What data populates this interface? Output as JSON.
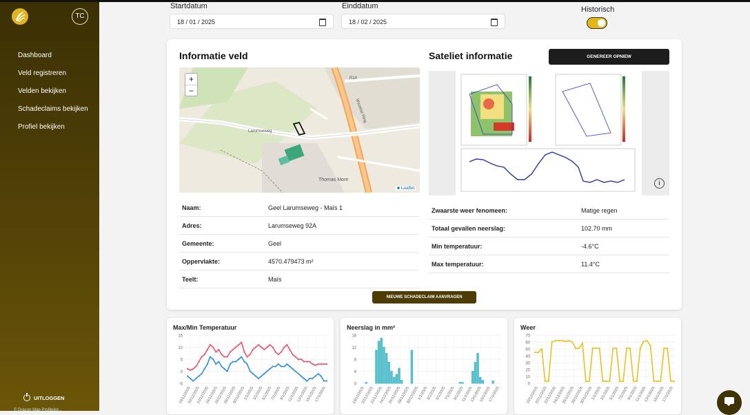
{
  "sidebar": {
    "avatar": "TC",
    "items": [
      {
        "label": "Dashboard"
      },
      {
        "label": "Veld registreren"
      },
      {
        "label": "Velden bekijken"
      },
      {
        "label": "Schadeclaims bekijken"
      },
      {
        "label": "Profiel bekijken"
      }
    ],
    "logout": "UITLOGGEN",
    "footer": "© Dracon Map Profilelist..."
  },
  "filters": {
    "start_label": "Startdatum",
    "start_value": "18 / 01 / 2025",
    "end_label": "Einddatum",
    "end_value": "18 / 02 / 2025",
    "toggle_label": "Historisch",
    "toggle_on": true
  },
  "field_info": {
    "title": "Informatie veld",
    "map": {
      "attribution": "Leaflet",
      "zoom_in": "+",
      "zoom_out": "−",
      "labels": [
        "Larumseweg",
        "Wezelse Ring",
        "R14",
        "Thomas More"
      ]
    },
    "rows": [
      {
        "key": "Naam:",
        "value": "Geel Larumseweg - Maïs 1"
      },
      {
        "key": "Adres:",
        "value": "Larumseweg 92A"
      },
      {
        "key": "Gemeente:",
        "value": "Geel"
      },
      {
        "key": "Oppervlakte:",
        "value": "4570.479473 m²"
      },
      {
        "key": "Teelt:",
        "value": "Maïs"
      }
    ]
  },
  "satellite": {
    "title": "Sateliet informatie",
    "regen_button": "GENEREER OPNIEW",
    "info_icon": "i",
    "rows": [
      {
        "key": "Zwaarste weer fenomeen:",
        "value": "Matige regen"
      },
      {
        "key": "Totaal gevallen neerslag:",
        "value": "102.70 mm"
      },
      {
        "key": "Min temperatuur:",
        "value": "-4.6°C"
      },
      {
        "key": "Max temperatuur:",
        "value": "11.4°C"
      }
    ]
  },
  "claim_button": "NIEUWE SCHADECLAIM AANVRAGEN",
  "colors": {
    "accent": "#e3b618",
    "sidebar": "#564507",
    "temp_max": "#e8546e",
    "temp_min": "#2f8fd8",
    "rain": "#3bb6c4",
    "weather": "#e7c21b"
  },
  "chart_data": [
    {
      "type": "line",
      "title": "Max/Min Temperatuur",
      "ylim": [
        -5,
        15
      ],
      "yticks": [
        15,
        10,
        5,
        0,
        -5
      ],
      "xticks": [
        "19/12/2025",
        "20/12/2025",
        "22/12/2025",
        "24/12/2025",
        "26/12/2025",
        "28/12/2025",
        "30/12/2025",
        "1/1/2025",
        "3/1/2025",
        "5/1/2025",
        "7/1/2025",
        "9/1/2025",
        "11/1/2025",
        "13/1/2025",
        "15/1/2025",
        "17/1/2025"
      ],
      "series": [
        {
          "values": [
            1,
            0.5,
            1,
            2,
            4,
            6,
            7,
            9,
            11,
            10,
            8,
            9,
            7,
            6,
            6,
            8,
            9,
            10,
            11,
            12,
            8,
            6,
            7,
            9,
            10,
            11,
            10,
            9,
            10,
            11,
            10,
            8,
            7,
            8,
            10,
            11,
            9,
            7,
            6,
            5,
            5,
            4,
            4,
            4,
            3,
            2.5,
            3,
            3,
            3,
            3
          ]
        },
        {
          "values": [
            -2,
            -3,
            -4,
            -3,
            -2,
            -1,
            1,
            3,
            6,
            5,
            3,
            4,
            2,
            1,
            0,
            3,
            4,
            4,
            5,
            6,
            4,
            3,
            0,
            -1,
            -2,
            -3,
            -2,
            -1,
            0,
            1,
            2,
            2,
            3,
            2,
            2,
            3,
            2,
            1,
            0,
            -1,
            -2,
            -3,
            -4,
            -3,
            -3,
            -2,
            -1,
            -2,
            -4,
            -4
          ]
        }
      ]
    },
    {
      "type": "bar",
      "title": "Neerslag in mm²",
      "ylim": [
        0,
        16
      ],
      "yticks": [
        16,
        12,
        8,
        4,
        0
      ],
      "xticks": [
        "19/12/2025",
        "20/12/2025",
        "22/12/2025",
        "24/12/2025",
        "26/12/2025",
        "28/12/2025",
        "30/12/2025",
        "1/1/2025",
        "3/1/2025",
        "5/1/2025",
        "7/1/2025",
        "9/1/2025",
        "11/1/2025",
        "13/1/2025",
        "15/1/2025",
        "17/1/2025"
      ],
      "values": [
        0,
        0,
        0.3,
        0,
        0,
        0,
        11,
        14,
        15,
        12,
        10,
        7,
        4,
        2,
        3,
        5,
        1,
        0,
        0,
        0,
        11,
        0,
        0,
        0,
        0,
        0,
        0,
        0,
        0,
        0,
        0,
        0,
        0,
        0,
        0,
        0,
        0,
        0,
        0,
        0.3,
        0.3,
        0,
        0,
        0,
        4,
        7,
        10,
        2,
        1,
        0,
        0,
        0,
        0.8,
        0,
        0,
        0
      ]
    },
    {
      "type": "line",
      "title": "Weer",
      "ylim": [
        0,
        70
      ],
      "yticks": [
        70,
        60,
        50,
        40,
        30,
        20,
        10,
        0
      ],
      "xticks": [
        "19/12/2025",
        "20/12/2025",
        "22/12/2025",
        "24/12/2025",
        "26/12/2025",
        "28/12/2025",
        "30/12/2025",
        "1/1/2025",
        "3/1/2025",
        "5/1/2025",
        "7/1/2025",
        "9/1/2025",
        "11/1/2025",
        "13/1/2025",
        "15/1/2025",
        "17/1/2025"
      ],
      "series": [
        {
          "values": [
            45,
            45,
            50,
            3,
            3,
            60,
            62,
            62,
            62,
            61,
            62,
            60,
            51,
            51,
            58,
            3,
            3,
            51,
            51,
            51,
            3,
            3,
            3,
            51,
            51,
            3,
            3,
            51,
            51,
            3,
            3,
            51,
            61,
            62,
            55,
            3,
            3,
            3,
            51,
            51,
            3,
            3
          ]
        }
      ]
    }
  ]
}
